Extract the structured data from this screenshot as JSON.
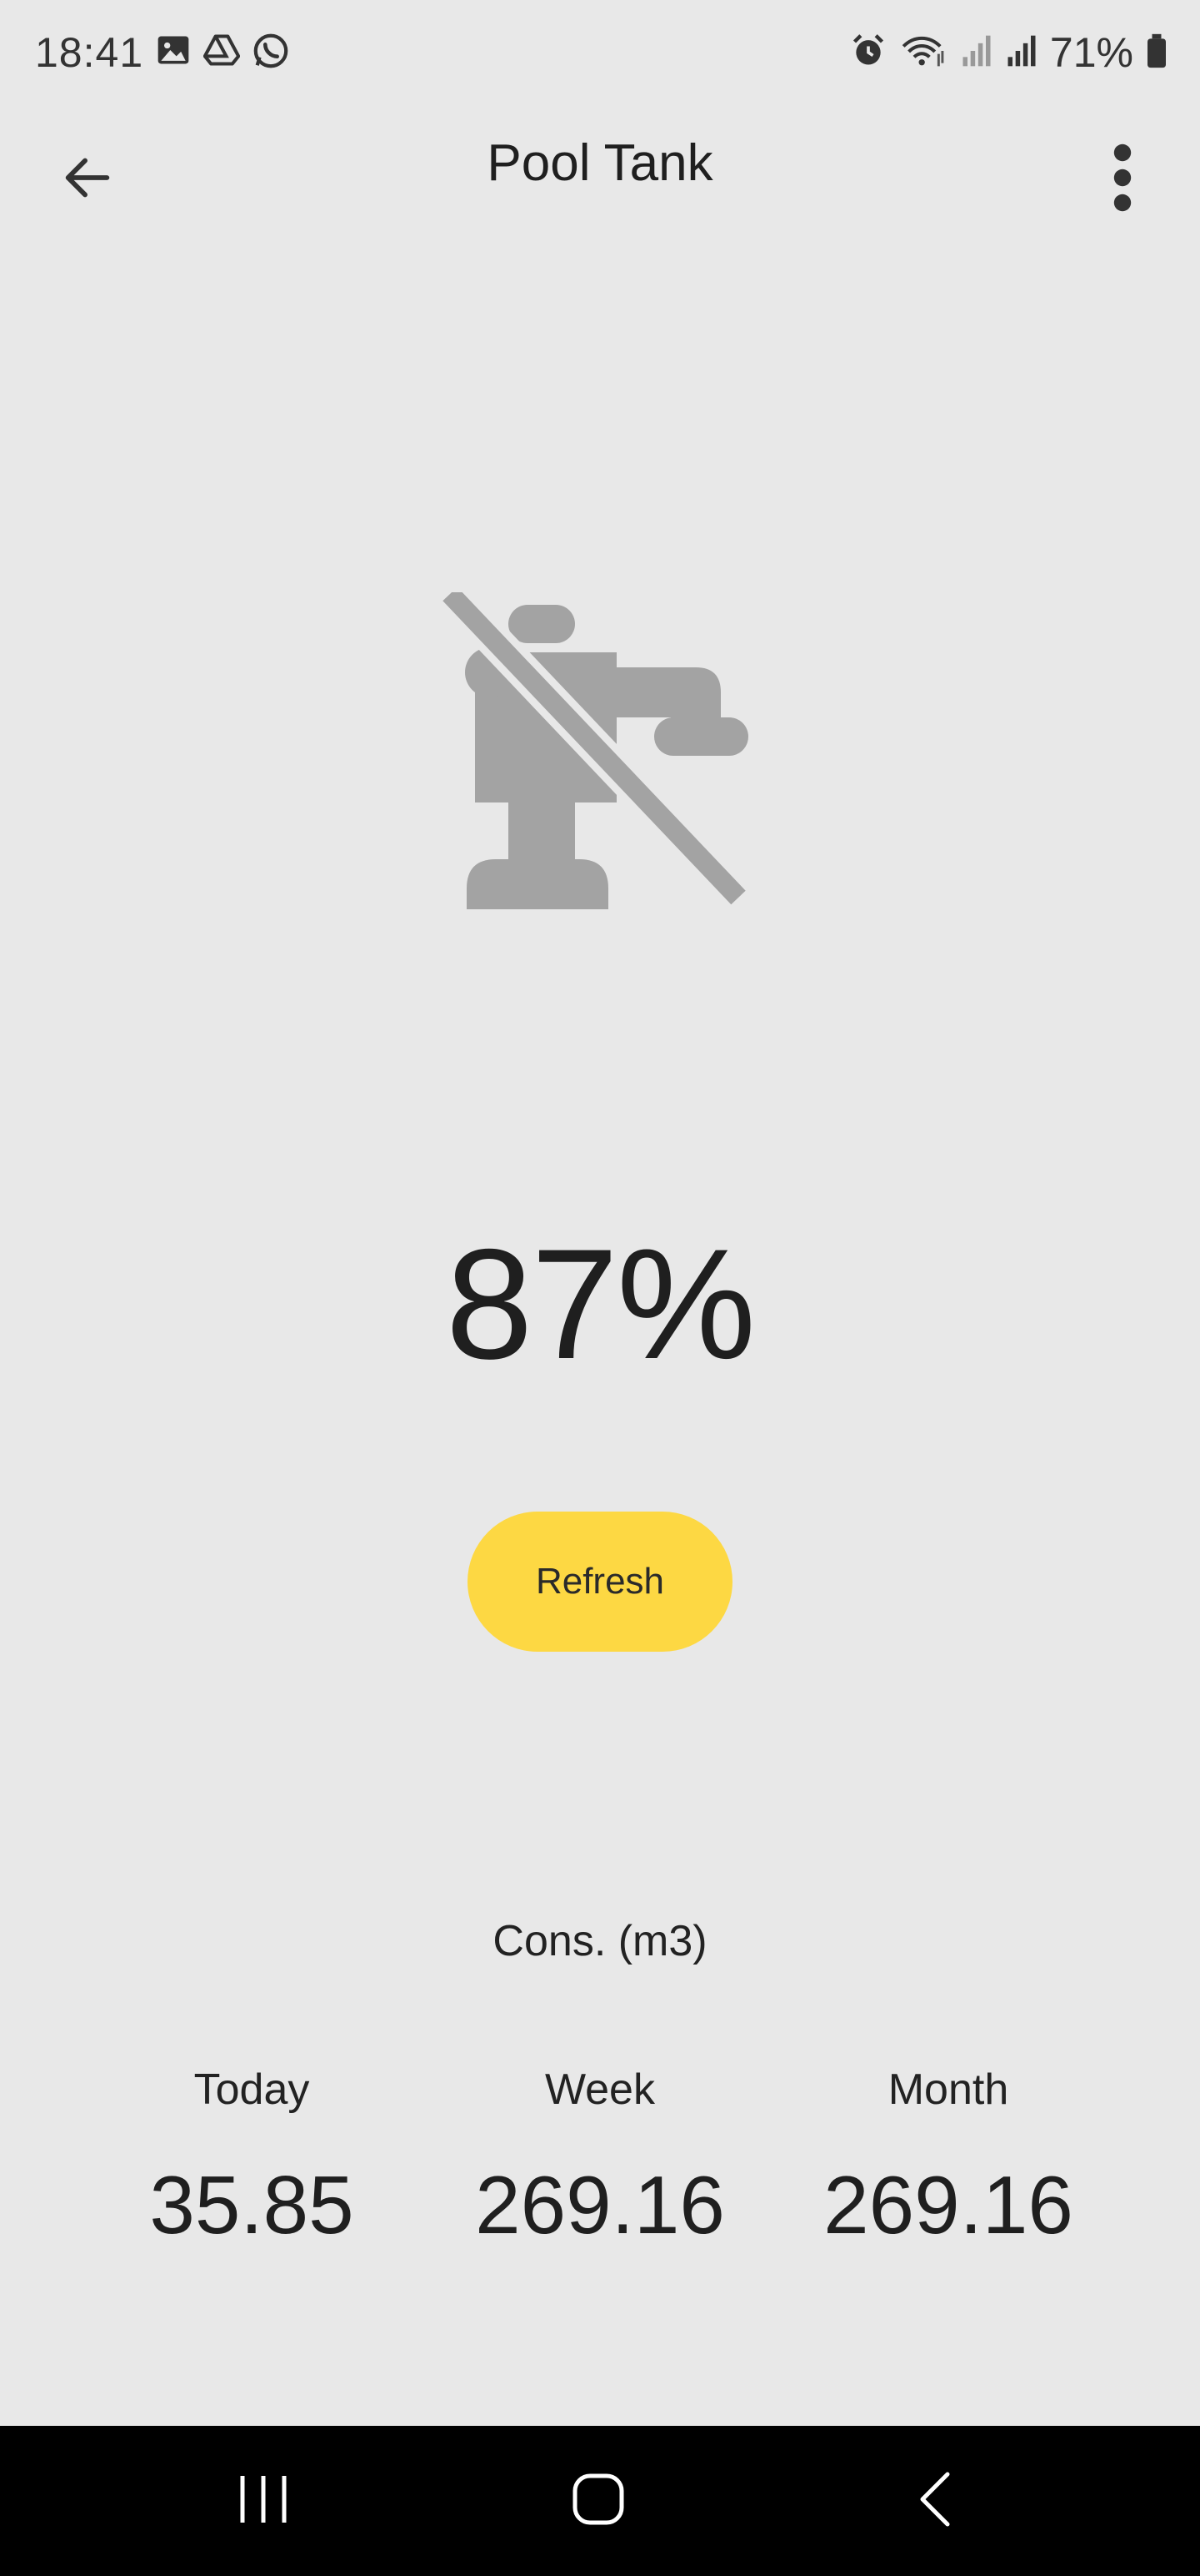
{
  "status_bar": {
    "time": "18:41",
    "left_icons": [
      "image-icon",
      "drive-icon",
      "whatsapp-icon"
    ],
    "right_icons": [
      "alarm-icon",
      "wifi-icon",
      "signal-icon",
      "signal-icon",
      "battery-icon"
    ],
    "battery": "71%"
  },
  "app_bar": {
    "title": "Pool Tank",
    "back_icon": "arrow-back-icon",
    "menu_icon": "more-vert-icon"
  },
  "device": {
    "icon": "faucet-off-icon",
    "level": "87%"
  },
  "actions": {
    "refresh_label": "Refresh"
  },
  "consumption": {
    "label": "Cons. (m3)",
    "stats": [
      {
        "label": "Today",
        "value": "35.85"
      },
      {
        "label": "Week",
        "value": "269.16"
      },
      {
        "label": "Month",
        "value": "269.16"
      }
    ]
  },
  "nav_bar": {
    "buttons": [
      "recent-apps-icon",
      "home-icon",
      "back-icon"
    ]
  },
  "colors": {
    "background": "#e8e8e8",
    "accent": "#fdd843",
    "icon_gray": "#a3a3a3",
    "nav_bar": "#000000"
  }
}
